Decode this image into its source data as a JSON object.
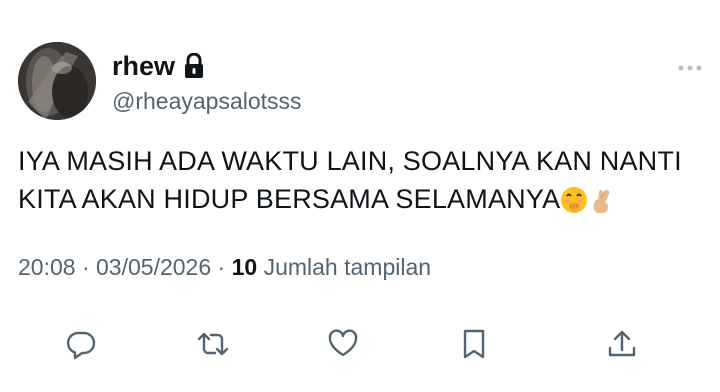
{
  "user": {
    "display_name": "rhew",
    "handle": "@rheayapsalotsss",
    "protected_icon": "lock-icon",
    "avatar_icon": "avatar-photo"
  },
  "tweet": {
    "line1": "IYA MASIH ADA WAKTU LAIN, SOALNYA KAN NANTI",
    "line2": "KITA AKAN HIDUP BERSAMA SELAMANYA",
    "emojis": [
      "face-with-hand-over-mouth",
      "crossed-fingers"
    ]
  },
  "meta": {
    "time": "20:08",
    "separator1": " · ",
    "date": "03/05/2026",
    "separator2": " · ",
    "views_count": "10",
    "views_label": "Jumlah tampilan"
  },
  "actions": {
    "reply_icon": "reply-icon",
    "retweet_icon": "retweet-icon",
    "like_icon": "heart-icon",
    "bookmark_icon": "bookmark-icon",
    "share_icon": "share-icon"
  },
  "colors": {
    "text": "#0f1419",
    "secondary": "#536471",
    "background": "#ffffff"
  }
}
